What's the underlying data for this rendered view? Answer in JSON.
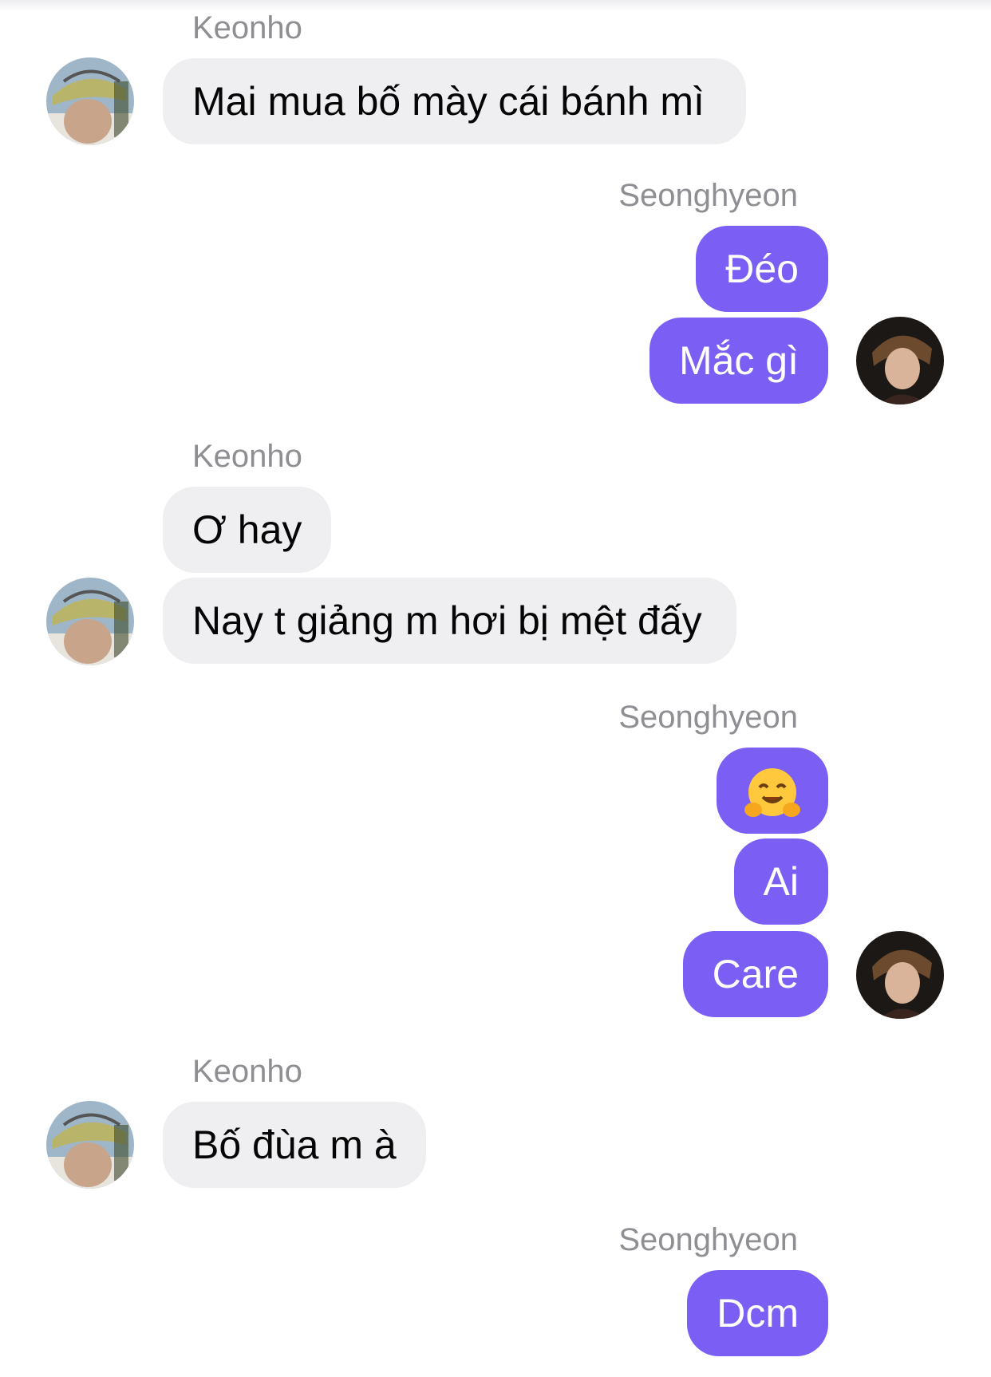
{
  "colors": {
    "outgoing_bubble": "#7b5ef4",
    "incoming_bubble": "#efeff1",
    "sender_name": "#8e8e93"
  },
  "groups": [
    {
      "sender": "Keonho",
      "side": "incoming",
      "messages": [
        "Mai mua bố mày cái bánh mì"
      ]
    },
    {
      "sender": "Seonghyeon",
      "side": "outgoing",
      "messages": [
        "Đéo",
        "Mắc gì"
      ]
    },
    {
      "sender": "Keonho",
      "side": "incoming",
      "messages": [
        "Ơ hay",
        "Nay t giảng m hơi bị mệt đấy"
      ]
    },
    {
      "sender": "Seonghyeon",
      "side": "outgoing",
      "messages": [
        "🤗",
        "Ai",
        "Care"
      ]
    },
    {
      "sender": "Keonho",
      "side": "incoming",
      "messages": [
        "Bố đùa m à"
      ]
    },
    {
      "sender": "Seonghyeon",
      "side": "outgoing",
      "messages": [
        "Dcm"
      ]
    }
  ],
  "icons": {
    "keonho_avatar": "avatar-photo-bucket-hat",
    "seonghyeon_avatar": "avatar-photo-dark",
    "hug_emoji": "hugging-face-emoji"
  }
}
